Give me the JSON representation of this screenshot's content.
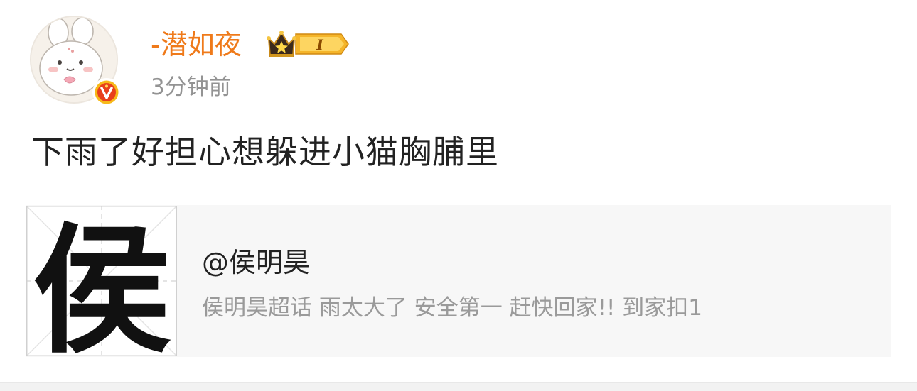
{
  "post": {
    "author": {
      "name": "-潜如夜",
      "avatar_icon": "bunny-avatar-icon",
      "verified_icon": "verified-v-icon",
      "vip_badge": {
        "icon": "crown-icon",
        "level": "I"
      }
    },
    "timestamp": "3分钟前",
    "content": "下雨了好担心想躲进小猫胸脯里",
    "card": {
      "thumbnail_char": "侯",
      "title": "@侯明昊",
      "description": "侯明昊超话 雨太大了 安全第一 赶快回家!! 到家扣1"
    }
  },
  "colors": {
    "username": "#ef7a1a",
    "verified_bg": "#e8401c",
    "verified_ring": "#f7b91a",
    "badge_gold": "#f5b52a",
    "timestamp": "#939393",
    "card_bg": "#f7f7f7"
  }
}
